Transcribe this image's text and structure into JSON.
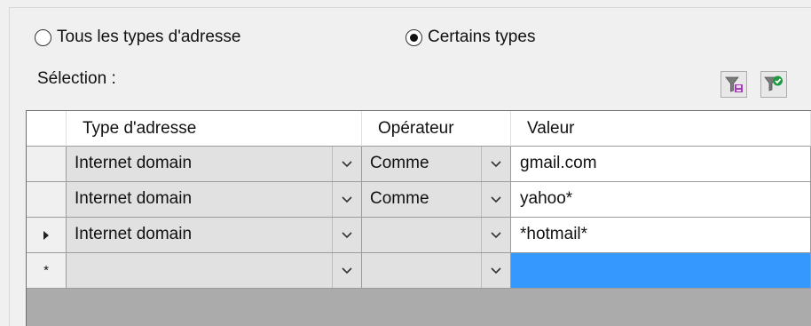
{
  "radios": {
    "all_label": "Tous les types d'adresse",
    "some_label": "Certains types",
    "selected": "some"
  },
  "selection_label": "Sélection :",
  "toolbar": {
    "filter_save_icon": "filter-save-icon",
    "filter_apply_icon": "filter-apply-icon"
  },
  "grid": {
    "columns": [
      "Type d'adresse",
      "Opérateur",
      "Valeur"
    ],
    "rows": [
      {
        "marker": "",
        "type": "Internet domain",
        "operator": "Comme",
        "value": "gmail.com"
      },
      {
        "marker": "",
        "type": "Internet domain",
        "operator": "Comme",
        "value": "yahoo*"
      },
      {
        "marker": "current",
        "type": "Internet domain",
        "operator": "",
        "value": "*hotmail*"
      },
      {
        "marker": "new",
        "type": "",
        "operator": "",
        "value": ""
      }
    ]
  },
  "colors": {
    "active_cell": "#3399ff",
    "grid_empty_area": "#ababab"
  }
}
